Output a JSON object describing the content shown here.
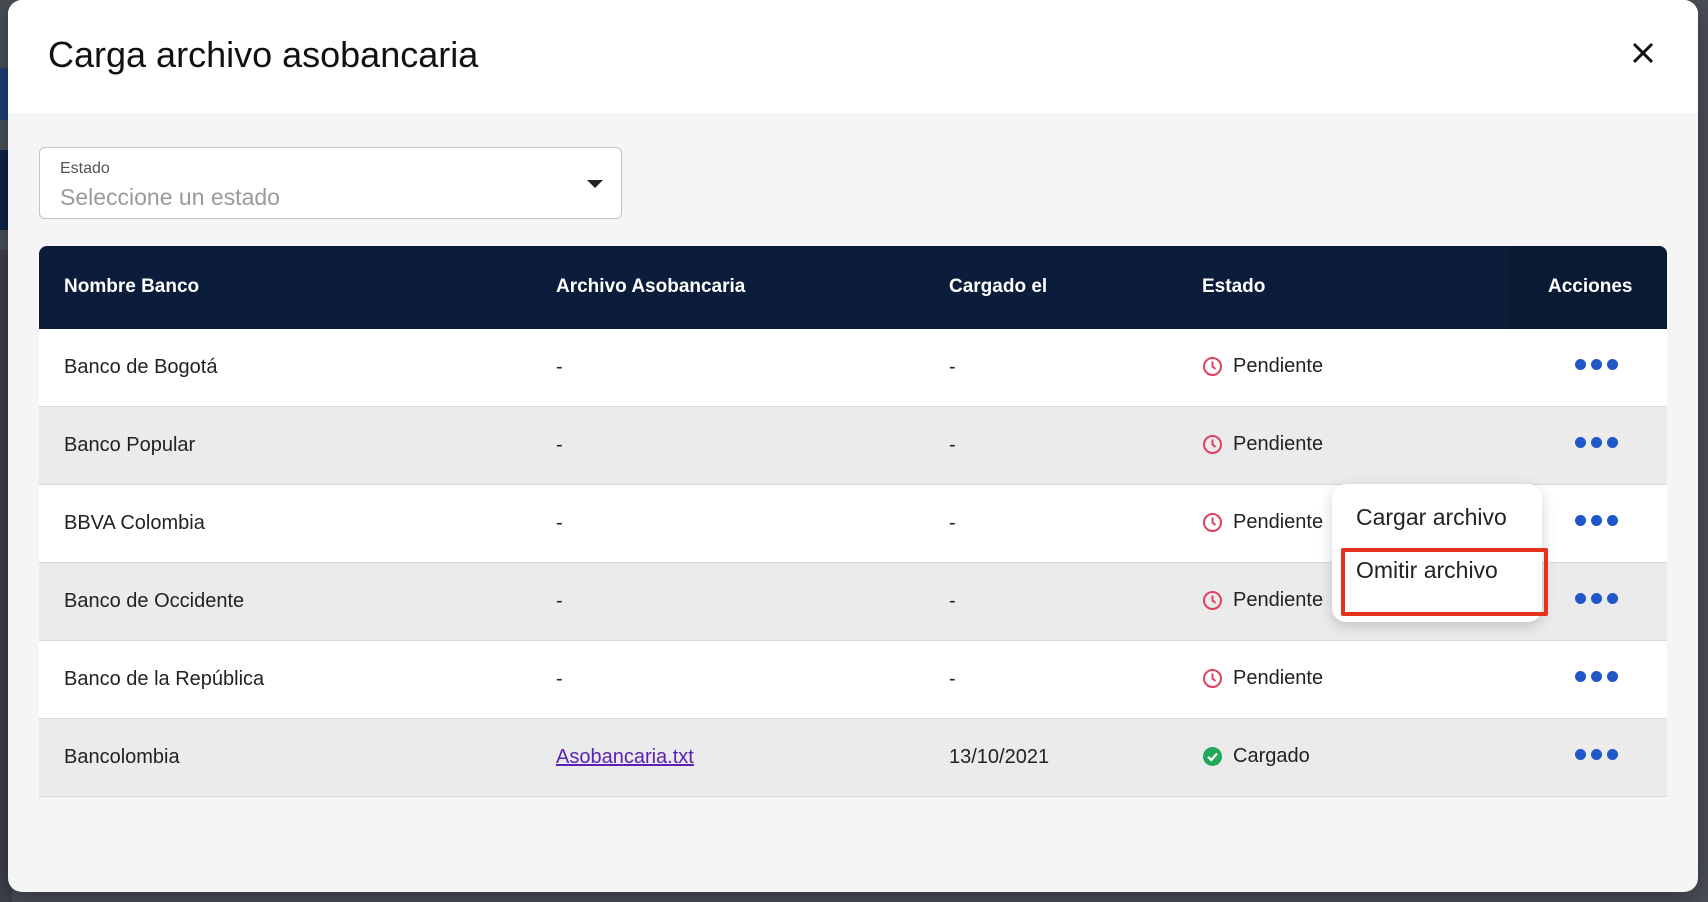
{
  "modal": {
    "title": "Carga archivo asobancaria",
    "close_icon": "close-icon"
  },
  "filter": {
    "label": "Estado",
    "placeholder": "Seleccione un estado"
  },
  "table": {
    "columns": [
      "Nombre Banco",
      "Archivo Asobancaria",
      "Cargado el",
      "Estado",
      "Acciones"
    ],
    "rows": [
      {
        "bank": "Banco de Bogotá",
        "file": "-",
        "date": "-",
        "status": "Pendiente"
      },
      {
        "bank": "Banco Popular",
        "file": "-",
        "date": "-",
        "status": "Pendiente"
      },
      {
        "bank": "BBVA Colombia",
        "file": "-",
        "date": "-",
        "status": "Pendiente"
      },
      {
        "bank": "Banco de Occidente",
        "file": "-",
        "date": "-",
        "status": "Pendiente"
      },
      {
        "bank": "Banco de la República",
        "file": "-",
        "date": "-",
        "status": "Pendiente"
      },
      {
        "bank": "Bancolombia",
        "file": "Asobancaria.txt",
        "date": "13/10/2021",
        "status": "Cargado"
      }
    ]
  },
  "context_menu": {
    "items": [
      "Cargar archivo",
      "Omitir archivo"
    ]
  },
  "colors": {
    "header_bg": "#0b1d3a",
    "pending": "#e0405e",
    "loaded": "#22a85a",
    "actions": "#1f56c9",
    "highlight": "#e5321a"
  }
}
